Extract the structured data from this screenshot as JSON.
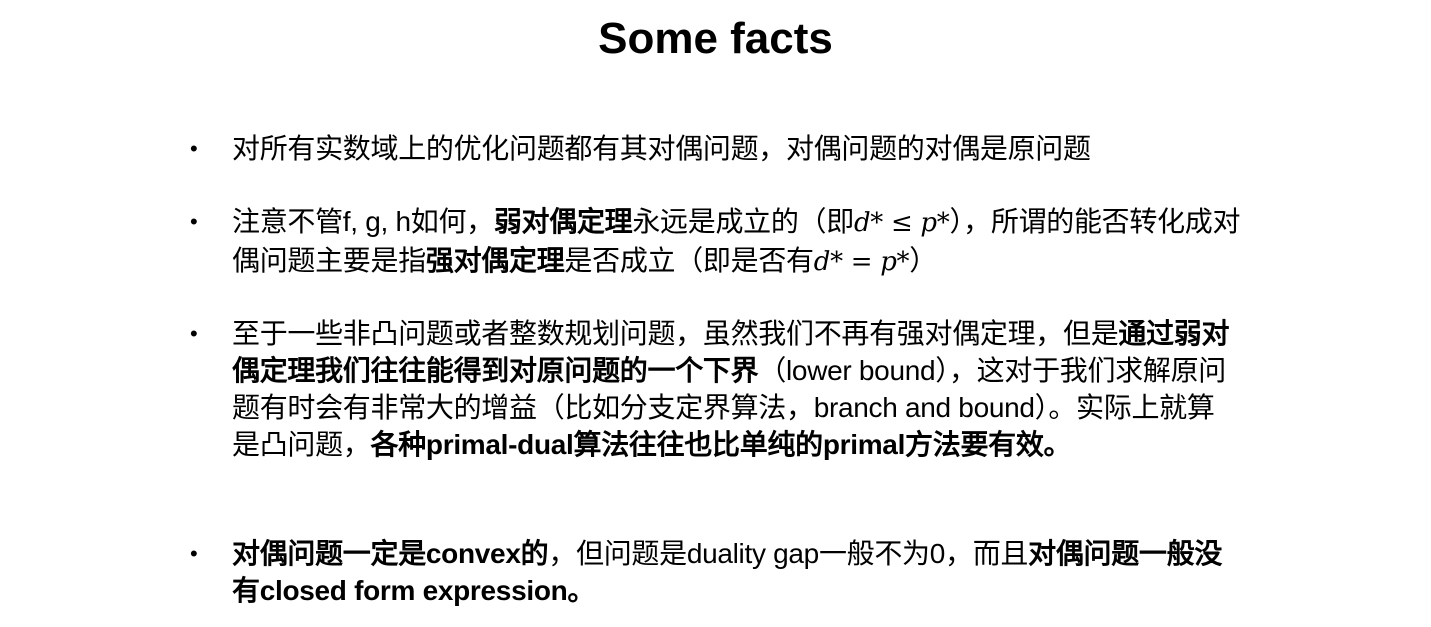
{
  "slide": {
    "title": "Some facts",
    "bullet_glyph": "•",
    "bullets": [
      {
        "segments": [
          {
            "text": "对所有实数域上的优化问题都有其对偶问题，对偶问题的对偶是原问题"
          }
        ]
      },
      {
        "segments": [
          {
            "text": "注意不管f, g, h如何，"
          },
          {
            "text": "弱对偶定理"
          },
          {
            "text": "永远是成立的（即"
          },
          {
            "text": "d* ≤ p*"
          },
          {
            "text": "），所谓的能否转化成对偶问题主要是指"
          },
          {
            "text": "强对偶定理"
          },
          {
            "text": "是否成立（即是否有"
          },
          {
            "text": "d* = p*"
          },
          {
            "text": "）"
          }
        ]
      },
      {
        "segments": [
          {
            "text": "至于一些非凸问题或者整数规划问题，虽然我们不再有强对偶定理，但是"
          },
          {
            "text": "通过弱对偶定理我们往往能得到对原问题的一个下界"
          },
          {
            "text": "（lower bound），这对于我们求解原问题有时会有非常大的增益（比如分支定界算法，branch and bound）。实际上就算是凸问题，"
          },
          {
            "text": "各种primal-dual算法往往也比单纯的primal方法要有效。"
          }
        ]
      },
      {
        "segments": [
          {
            "text": "对偶问题一定是convex的"
          },
          {
            "text": "，但问题是duality gap一般不为0，而且"
          },
          {
            "text": "对偶问题一般没有closed form expression。"
          }
        ]
      }
    ]
  }
}
